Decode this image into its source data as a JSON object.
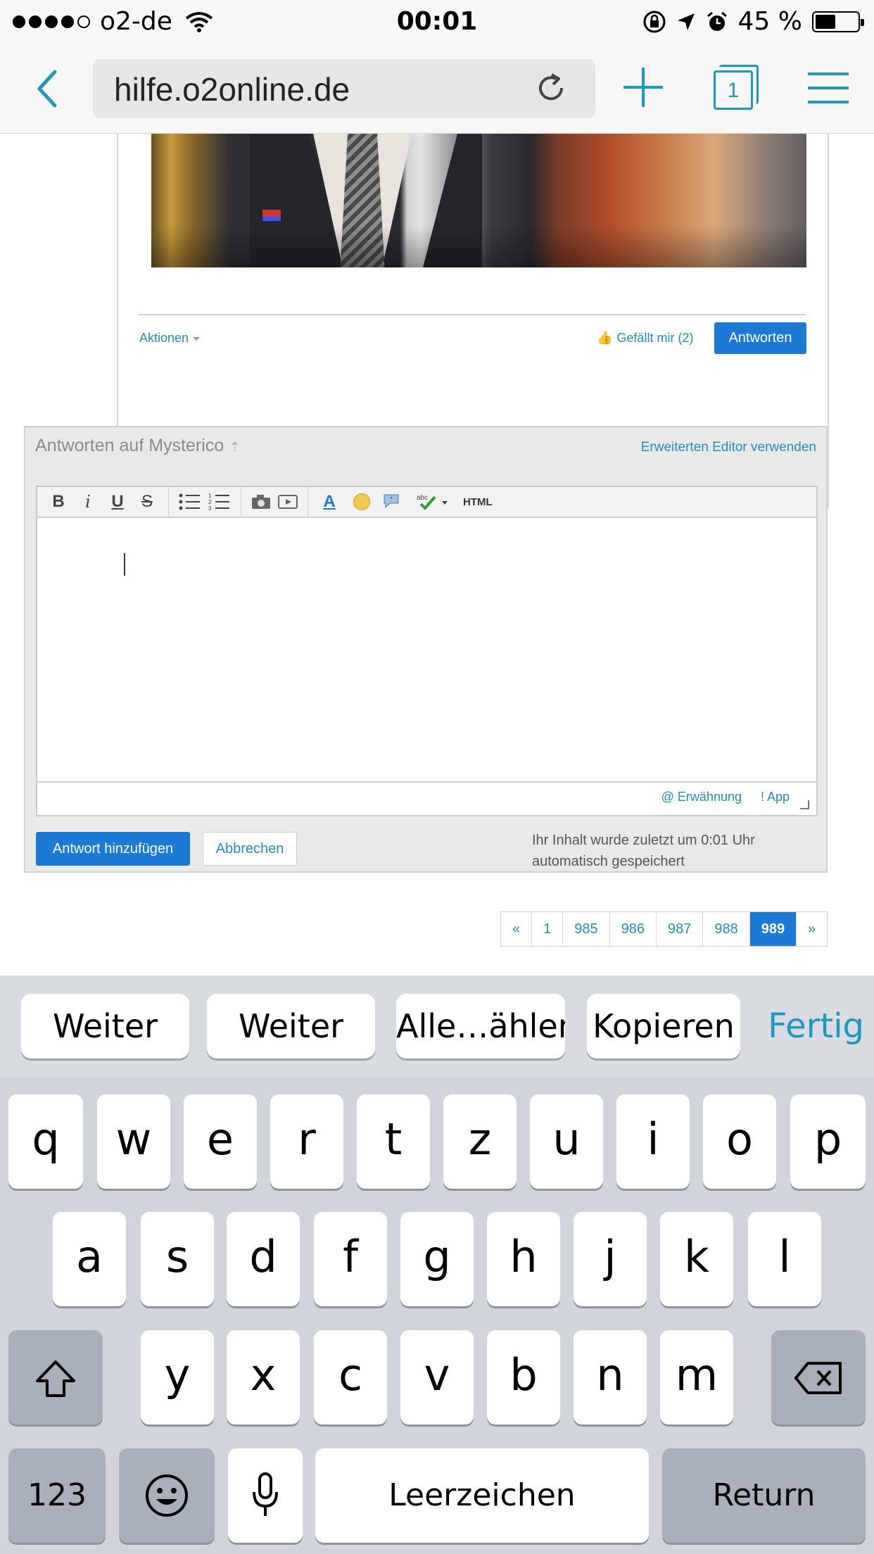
{
  "status_bar": {
    "carrier": "o2-de",
    "time": "00:01",
    "battery": "45 %",
    "signal_bars_filled": 4,
    "signal_bars_total": 5
  },
  "browser": {
    "url": "hilfe.o2online.de",
    "tab_count": "1",
    "icons": [
      "back-chevron-icon",
      "reload-icon",
      "plus-icon",
      "tabs-icon",
      "menu-icon"
    ],
    "accent_color": "#1a9bbd"
  },
  "post": {
    "actions_label": "Aktionen",
    "like_label": "Gefällt mir (2)",
    "reply_button": "Antworten"
  },
  "reply": {
    "title": "Antworten auf Mysterico",
    "advanced_editor_link": "Erweiterten Editor verwenden",
    "toolbar": {
      "bold": "B",
      "italic": "i",
      "underline": "U",
      "strike": "S",
      "html": "HTML",
      "font": "A"
    },
    "mention": "@ Erwähnung",
    "app": "! App",
    "add_button": "Antwort hinzufügen",
    "cancel_button": "Abbrechen",
    "autosave_line1": "Ihr Inhalt wurde zuletzt um 0:01 Uhr",
    "autosave_line2": "automatisch gespeichert"
  },
  "pagination": {
    "prev": "«",
    "pages": [
      "1",
      "985",
      "986",
      "987",
      "988"
    ],
    "current": "989",
    "next": "»"
  },
  "keyboard": {
    "suggestions": [
      "Weiter",
      "Weiter",
      "Alle…ählen",
      "Kopieren"
    ],
    "done": "Fertig",
    "row1": [
      "q",
      "w",
      "e",
      "r",
      "t",
      "z",
      "u",
      "i",
      "o",
      "p"
    ],
    "row2": [
      "a",
      "s",
      "d",
      "f",
      "g",
      "h",
      "j",
      "k",
      "l"
    ],
    "row3": [
      "y",
      "x",
      "c",
      "v",
      "b",
      "n",
      "m"
    ],
    "numbers": "123",
    "space": "Leerzeichen",
    "return": "Return"
  },
  "colors": {
    "primary_button": "#1a7ad6",
    "link": "#1d8fc6"
  }
}
